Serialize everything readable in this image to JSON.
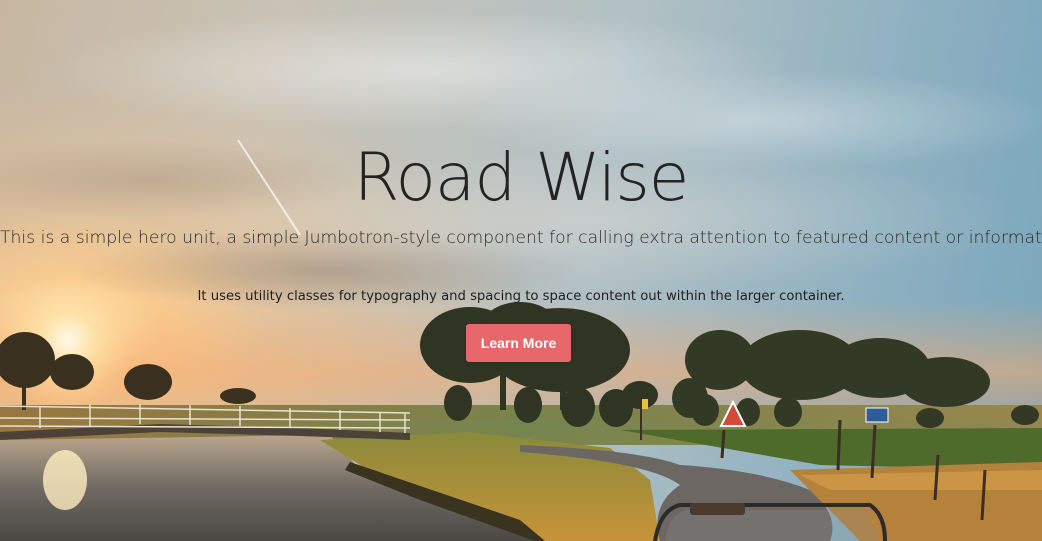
{
  "hero": {
    "title": "Road Wise",
    "lead": "This is a simple hero unit, a simple Jumbotron-style component for calling extra attention to featured content or information.",
    "subtext": "It uses utility classes for typography and spacing to space content out within the larger container.",
    "button_label": "Learn More"
  },
  "theme": {
    "button_color": "#e8676b",
    "title_color": "#232323"
  },
  "background": {
    "scene": "sunset countryside road with canal, bridge and trees"
  }
}
